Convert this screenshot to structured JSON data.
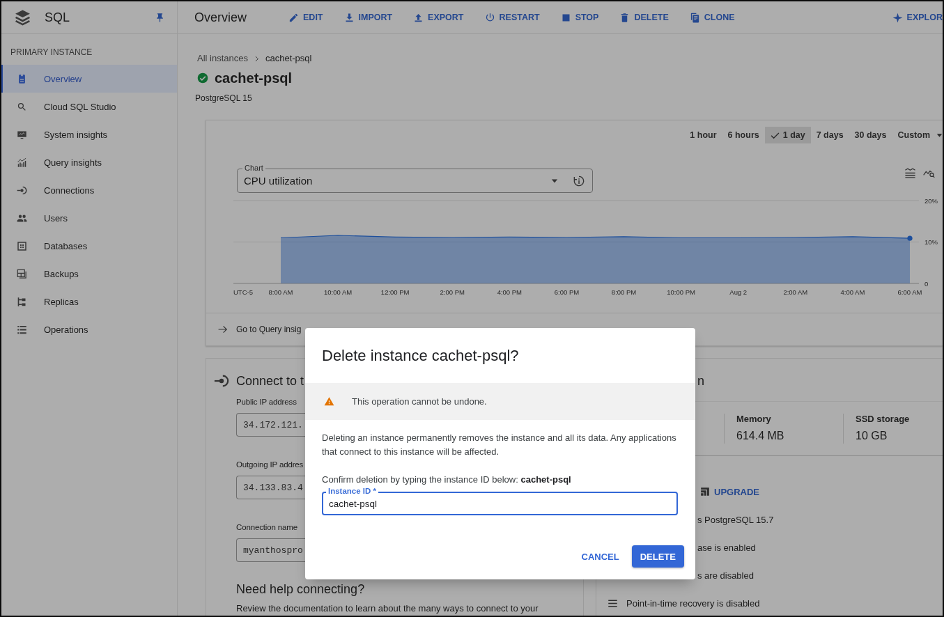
{
  "header": {
    "product": "SQL",
    "page_title": "Overview",
    "actions": [
      {
        "label": "EDIT"
      },
      {
        "label": "IMPORT"
      },
      {
        "label": "EXPORT"
      },
      {
        "label": "RESTART"
      },
      {
        "label": "STOP"
      },
      {
        "label": "DELETE"
      },
      {
        "label": "CLONE"
      }
    ],
    "explore": "EXPLOR"
  },
  "sidebar": {
    "heading": "PRIMARY INSTANCE",
    "items": [
      {
        "label": "Overview",
        "selected": true
      },
      {
        "label": "Cloud SQL Studio",
        "selected": false
      },
      {
        "label": "System insights",
        "selected": false
      },
      {
        "label": "Query insights",
        "selected": false
      },
      {
        "label": "Connections",
        "selected": false
      },
      {
        "label": "Users",
        "selected": false
      },
      {
        "label": "Databases",
        "selected": false
      },
      {
        "label": "Backups",
        "selected": false
      },
      {
        "label": "Replicas",
        "selected": false
      },
      {
        "label": "Operations",
        "selected": false
      }
    ]
  },
  "breadcrumb": {
    "items": [
      "All instances",
      "cachet-psql"
    ]
  },
  "instance": {
    "name": "cachet-psql",
    "running": true,
    "version": "PostgreSQL 15"
  },
  "monitoring": {
    "time_ranges": [
      {
        "label": "1 hour",
        "selected": false
      },
      {
        "label": "6 hours",
        "selected": false
      },
      {
        "label": "1 day",
        "selected": true
      },
      {
        "label": "7 days",
        "selected": false
      },
      {
        "label": "30 days",
        "selected": false
      }
    ],
    "custom_range": "Custom",
    "chart_select": {
      "label": "Chart",
      "value": "CPU utilization"
    },
    "chart_data": {
      "type": "area",
      "categories": [
        "8:00 AM",
        "10:00 AM",
        "12:00 PM",
        "2:00 PM",
        "4:00 PM",
        "6:00 PM",
        "8:00 PM",
        "10:00 PM",
        "Aug 2",
        "2:00 AM",
        "4:00 AM",
        "6:00 AM"
      ],
      "series": [
        {
          "color": "#1d4f9c",
          "values": [
            11.0,
            11.6,
            11.2,
            11.1,
            11.2,
            11.1,
            11.3,
            11.0,
            11.0,
            11.1,
            11.3,
            10.9
          ]
        }
      ],
      "ylim": [
        0,
        20
      ],
      "yticks": [
        {
          "value": 0,
          "label": "0"
        },
        {
          "value": 10,
          "label": "10%"
        },
        {
          "value": 20,
          "label": "20%"
        }
      ],
      "annotations": [
        {
          "text": "UTC-5"
        }
      ]
    },
    "query_insights_link": "Go to Query insig"
  },
  "connect_card": {
    "heading": "Connect to t",
    "fields": [
      {
        "label": "Public IP address",
        "value": "34.172.121."
      },
      {
        "label": "Outgoing IP addres",
        "value": "34.133.83.4"
      },
      {
        "label": "Connection name",
        "value": "myanthospro"
      }
    ],
    "help_heading": "Need help connecting?",
    "help_text": "Review the documentation to learn about the many ways to connect to your"
  },
  "config_card": {
    "heading": "n",
    "stats": [
      {
        "label": "Memory",
        "value": "614.4 MB"
      },
      {
        "label": "SSD storage",
        "value": "10 GB"
      }
    ],
    "upgrade_button": "UPGRADE",
    "facts": [
      "s PostgreSQL 15.7",
      "ase is enabled",
      "s are disabled",
      "Point-in-time recovery is disabled"
    ]
  },
  "dialog": {
    "title": "Delete instance cachet-psql?",
    "warning": "This operation cannot be undone.",
    "body": "Deleting an instance permanently removes the instance and all its data. Any applications that connect to this instance will be affected.",
    "confirm_prompt": "Confirm deletion by typing the instance ID below: **cachet-psql**",
    "instance_field": {
      "label": "Instance ID *",
      "value": "cachet-psql",
      "focused": true
    },
    "buttons": [
      {
        "label": "CANCEL",
        "kind": "text"
      },
      {
        "label": "DELETE",
        "kind": "filled"
      }
    ]
  }
}
